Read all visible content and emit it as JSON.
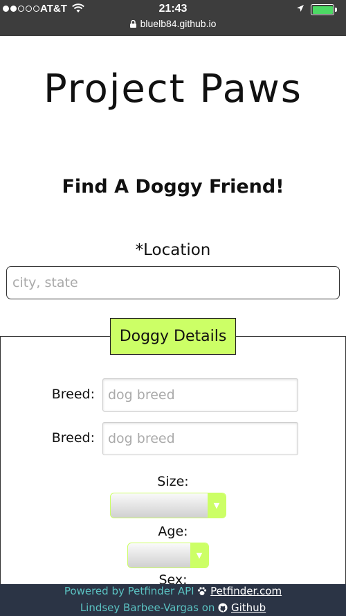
{
  "status_bar": {
    "carrier": "AT&T",
    "time": "21:43",
    "url": "bluelb84.github.io",
    "battery_level": 1.0,
    "signal_bars": 2
  },
  "header": {
    "title": "Project Paws",
    "subtitle": "Find A Doggy Friend!"
  },
  "location": {
    "label": "*Location",
    "placeholder": "city, state"
  },
  "details": {
    "legend": "Doggy Details",
    "breed_1": {
      "label": "Breed:",
      "placeholder": "dog breed"
    },
    "breed_2": {
      "label": "Breed:",
      "placeholder": "dog breed"
    },
    "size_label": "Size:",
    "age_label": "Age:",
    "sex_label": "Sex:"
  },
  "footer": {
    "powered_prefix": "Powered by Petfinder API",
    "petfinder_link": "Petfinder.com",
    "author_prefix": "Lindsey Barbee-Vargas on",
    "github_link": "Github"
  },
  "colors": {
    "accent": "#ccff66",
    "footer_bg": "#2b3445",
    "footer_text": "#5bc3c3",
    "status_bg": "#3d3d3d"
  },
  "icons": [
    "wifi-icon",
    "location-arrow-icon",
    "battery-icon",
    "lock-icon",
    "paw-icon",
    "github-icon",
    "select-arrow-icon"
  ]
}
